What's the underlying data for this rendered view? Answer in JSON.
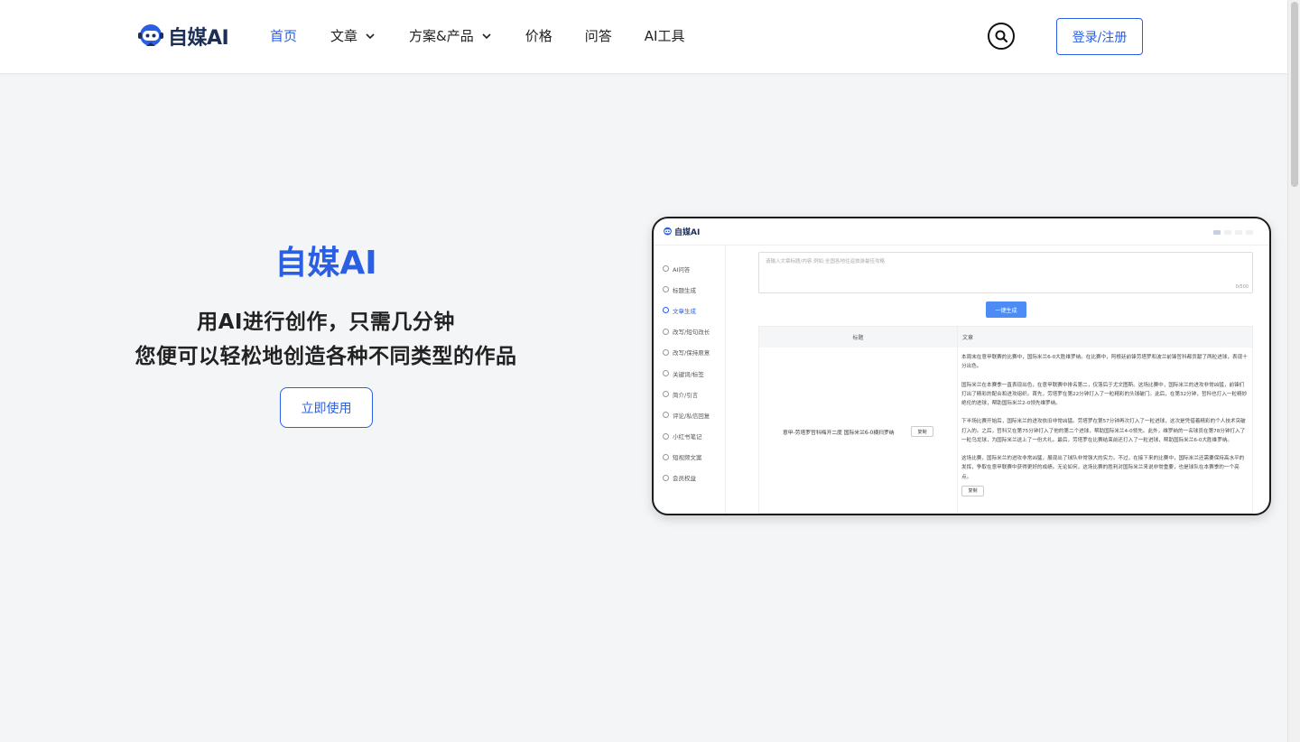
{
  "header": {
    "logo_text": "自媒AI",
    "nav": [
      {
        "label": "首页",
        "active": true,
        "dropdown": false
      },
      {
        "label": "文章",
        "active": false,
        "dropdown": true
      },
      {
        "label": "方案&产品",
        "active": false,
        "dropdown": true
      },
      {
        "label": "价格",
        "active": false,
        "dropdown": false
      },
      {
        "label": "问答",
        "active": false,
        "dropdown": false
      },
      {
        "label": "AI工具",
        "active": false,
        "dropdown": false
      }
    ],
    "login_label": "登录/注册"
  },
  "hero": {
    "title": "自媒AI",
    "subtitle_line1": "用AI进行创作，只需几分钟",
    "subtitle_line2": "您便可以轻松地创造各种不同类型的作品",
    "cta_label": "立即使用"
  },
  "preview": {
    "logo_text": "自媒AI",
    "sidebar": [
      {
        "label": "AI问答",
        "active": false
      },
      {
        "label": "标题生成",
        "active": false
      },
      {
        "label": "文章生成",
        "active": true
      },
      {
        "label": "改写/短句改长",
        "active": false
      },
      {
        "label": "改写/保持原意",
        "active": false
      },
      {
        "label": "关键词/标签",
        "active": false
      },
      {
        "label": "简介/引言",
        "active": false
      },
      {
        "label": "评论/私信回复",
        "active": false
      },
      {
        "label": "小红书笔记",
        "active": false
      },
      {
        "label": "短视频文案",
        "active": false
      },
      {
        "label": "会员权益",
        "active": false
      }
    ],
    "textarea_placeholder": "请输入文章标题/内容,例如:全国各地往返旅游最佳攻略",
    "char_count": "0/500",
    "generate_label": "一键生成",
    "table": {
      "headers": [
        "标题",
        "文章"
      ],
      "row_title": "意甲-劳塔罗哲科梅开二度 国际米兰6-0横扫罗纳",
      "copy_label": "复制",
      "paragraphs": [
        "本周末在意甲联赛的比赛中，国际米兰6-0大胜维罗纳。在比赛中，阿根廷前锋劳塔罗和波兰前锋哲科都贡献了两粒进球，表现十分出色。",
        "国际米兰在本赛季一直表现出色，在意甲联赛中排名第二，仅落后于尤文图斯。这场比赛中，国际米兰的进攻非常凶猛，前锋们打出了精彩的配合和进攻组织。首先，劳塔罗在第22分钟打入了一粒精彩的头球破门。此后，在第32分钟，哲科也打入一粒精妙绝伦的进球，帮助国际米兰2-0领先维罗纳。",
        "下半场比赛开始后，国际米兰的进攻依旧非常凶猛。劳塔罗在第57分钟再次打入了一粒进球，这次是凭借着精彩的个人技术突破打入的。之后，哲科又在第75分钟打入了他的第二个进球，帮助国际米兰4-0领先。此外，维罗纳的一名球员在第78分钟打入了一粒乌龙球，为国际米兰送上了一份大礼。最后，劳塔罗在比赛结束前还打入了一粒进球，帮助国际米兰6-0大胜维罗纳。",
        "这场比赛，国际米兰的进攻非常凶猛，展现出了球队非常强大的实力。不过，在接下来的比赛中，国际米兰还需要保持高水平的发挥，争取在意甲联赛中获得更好的成绩。无论如何，这场比赛的胜利对国际米兰来说非常重要，也是球队在本赛季的一个亮点。"
      ],
      "copy_label_2": "复制"
    }
  }
}
